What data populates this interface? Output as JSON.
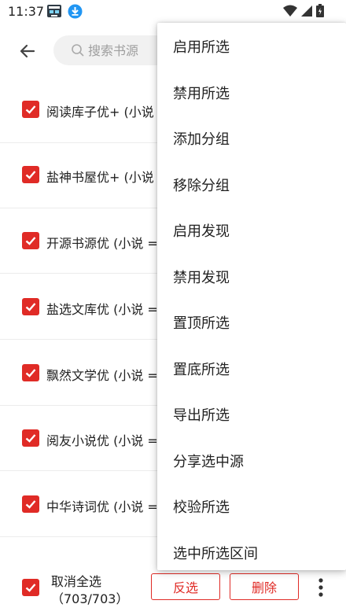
{
  "status_bar": {
    "time": "11:37"
  },
  "toolbar": {
    "search_placeholder": "搜索书源"
  },
  "sources": [
    {
      "label": "阅读库子优+ (小说 =",
      "checked": true
    },
    {
      "label": "盐神书屋优+ (小说 =",
      "checked": true
    },
    {
      "label": "开源书源优 (小说 =",
      "checked": true
    },
    {
      "label": "盐选文库优 (小说 =",
      "checked": true
    },
    {
      "label": "飘然文学优 (小说 =",
      "checked": true
    },
    {
      "label": "阅友小说优 (小说 =",
      "checked": true
    },
    {
      "label": "中华诗词优 (小说 =",
      "checked": true
    }
  ],
  "bottom_bar": {
    "select_all_label": "取消全选",
    "count": "（703/703）",
    "invert_label": "反选",
    "delete_label": "删除"
  },
  "menu": {
    "items": [
      "启用所选",
      "禁用所选",
      "添加分组",
      "移除分组",
      "启用发现",
      "禁用发现",
      "置顶所选",
      "置底所选",
      "导出所选",
      "分享选中源",
      "校验所选",
      "选中所选区间"
    ]
  },
  "colors": {
    "accent": "#e02b26",
    "text": "#212121",
    "divider": "#ececec"
  }
}
